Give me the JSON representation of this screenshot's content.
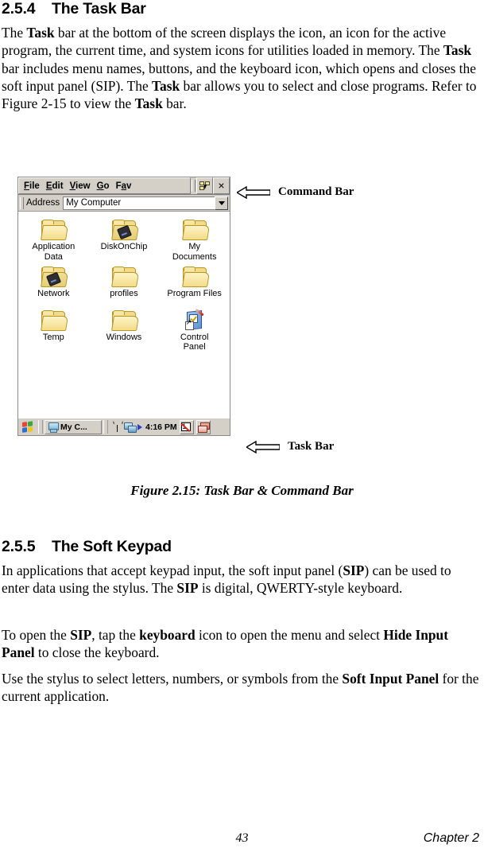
{
  "sections": [
    {
      "number": "2.5.4",
      "title": "The Task Bar"
    },
    {
      "number": "2.5.5",
      "title": "The Soft Keypad"
    }
  ],
  "paragraphs": {
    "intro_1": "The ",
    "intro_1b": "Task",
    "intro_1c": " bar at the bottom of the screen displays the icon, an icon for the active program, the current time, and system icons for utilities loaded in memory. The ",
    "intro_1d": "Task",
    "intro_1e": " bar includes menu names, buttons, and the keyboard icon, which opens and closes the soft input panel (SIP). The ",
    "intro_1f": "Task",
    "intro_1g": " bar allows you to select and close programs. Refer to Figure 2-15 to view the ",
    "intro_1h": "Task",
    "intro_1i": " bar.",
    "sip_1a": "In applications that accept keypad input, the soft input panel (",
    "sip_1b": "SIP",
    "sip_1c": ") can be used to enter data using the stylus. The ",
    "sip_1d": "SIP",
    "sip_1e": " is digital, QWERTY-style keyboard.",
    "sip_2a": "To open the ",
    "sip_2b": "SIP",
    "sip_2c": ", tap the ",
    "sip_2d": "keyboard",
    "sip_2e": " icon to open the menu and select ",
    "sip_2f": "Hide Input Panel",
    "sip_2g": " to close the keyboard.",
    "sip_3a": "Use the stylus to select letters, numbers, or symbols from the ",
    "sip_3b": "Soft Input Panel",
    "sip_3c": " for the current application."
  },
  "figure": {
    "caption": "Figure 2.15: Task Bar & Command Bar",
    "callouts": {
      "command_bar": "Command Bar",
      "task_bar": "Task Bar"
    },
    "command_bar": {
      "menus": [
        {
          "accel": "F",
          "rest": "ile"
        },
        {
          "accel": "E",
          "rest": "dit"
        },
        {
          "accel": "V",
          "rest": "iew"
        },
        {
          "accel": "G",
          "rest": "o"
        },
        {
          "accel": "a",
          "rest": "v",
          "pre": "F"
        }
      ],
      "view_button": "view-icon",
      "close_button": "×"
    },
    "address_bar": {
      "label": "Address",
      "value": "My Computer"
    },
    "desktop_icons": [
      {
        "label": "Application\nData",
        "icon": "folder"
      },
      {
        "label": "DiskOnChip",
        "icon": "folder-chip"
      },
      {
        "label": "My\nDocuments",
        "icon": "folder"
      },
      {
        "label": "Network",
        "icon": "folder-chip"
      },
      {
        "label": "profiles",
        "icon": "folder"
      },
      {
        "label": "Program Files",
        "icon": "folder"
      },
      {
        "label": "Temp",
        "icon": "folder"
      },
      {
        "label": "Windows",
        "icon": "folder"
      },
      {
        "label": "Control\nPanel",
        "icon": "control-panel"
      }
    ],
    "task_bar": {
      "start": "start-button",
      "task_button": "My C...",
      "tray_icons": [
        "antenna-icon",
        "network-icon",
        "play-arrow-icon"
      ],
      "clock": "4:16 PM",
      "sip_button": "sip-keyboard-icon",
      "desktop_button": "show-desktop-icon"
    }
  },
  "footer": {
    "page_number": "43",
    "chapter": "Chapter 2"
  }
}
